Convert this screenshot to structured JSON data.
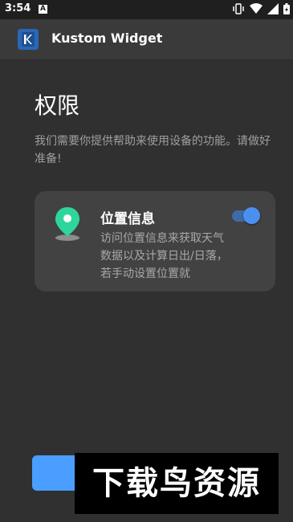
{
  "status_bar": {
    "time": "3:54",
    "notification_letter": "A",
    "icons": [
      "vibrate-icon",
      "wifi-icon",
      "signal-icon",
      "battery-icon"
    ]
  },
  "app_bar": {
    "title": "Kustom Widget",
    "logo_letter": "K",
    "logo_color": "#2a67b6"
  },
  "page": {
    "title": "权限",
    "description": "我们需要你提供帮助来使用设备的功能。请做好准备!"
  },
  "permission_card": {
    "title": "位置信息",
    "description": "访问位置信息来获取天气数据以及计算日出/日落，若手动设置位置就",
    "enabled": true,
    "icon": "location-pin-icon",
    "icon_color": "#2fd69b",
    "toggle_color": "#4a90f0"
  },
  "watermark": {
    "text": "下载鸟资源"
  },
  "colors": {
    "background": "#303030",
    "card": "#424242",
    "accent": "#4a9eff"
  }
}
